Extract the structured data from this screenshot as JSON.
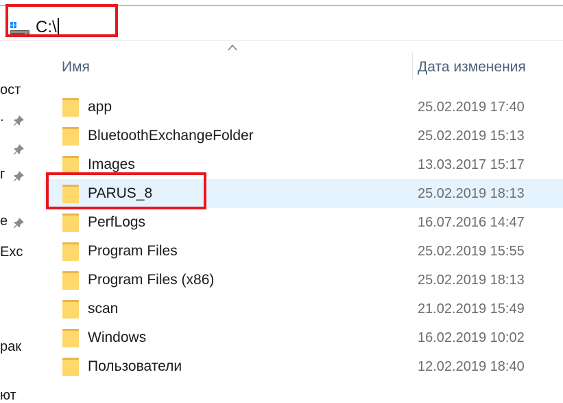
{
  "address_bar": {
    "path": "C:\\"
  },
  "nav_pane": {
    "items": [
      {
        "text": "ост",
        "pinned": false
      },
      {
        "text": "·",
        "pinned": true
      },
      {
        "text": "",
        "pinned": true
      },
      {
        "text": "г",
        "pinned": true
      },
      {
        "text": "е",
        "pinned": true
      },
      {
        "text": "Exc",
        "pinned": false
      },
      {
        "text": "рак",
        "pinned": false
      },
      {
        "text": "ют",
        "pinned": false
      }
    ]
  },
  "columns": {
    "name": "Имя",
    "date_modified": "Дата изменения",
    "sorted_by": "name"
  },
  "files": [
    {
      "name": "app",
      "date": "25.02.2019 17:40",
      "icon": "folder-icon",
      "selected": false
    },
    {
      "name": "BluetoothExchangeFolder",
      "date": "25.02.2019 15:13",
      "icon": "folder-icon",
      "selected": false
    },
    {
      "name": "Images",
      "date": "13.03.2017 15:17",
      "icon": "folder-icon",
      "selected": false
    },
    {
      "name": "PARUS_8",
      "date": "25.02.2019 18:13",
      "icon": "folder-icon",
      "selected": true
    },
    {
      "name": "PerfLogs",
      "date": "16.07.2016 14:47",
      "icon": "folder-icon",
      "selected": false
    },
    {
      "name": "Program Files",
      "date": "25.02.2019 15:55",
      "icon": "folder-icon",
      "selected": false
    },
    {
      "name": "Program Files (x86)",
      "date": "25.02.2019 18:13",
      "icon": "folder-icon",
      "selected": false
    },
    {
      "name": "scan",
      "date": "21.02.2019 15:49",
      "icon": "folder-icon",
      "selected": false
    },
    {
      "name": "Windows",
      "date": "16.02.2019 10:02",
      "icon": "folder-icon",
      "selected": false
    },
    {
      "name": "Пользователи",
      "date": "12.02.2019 18:40",
      "icon": "folder-icon",
      "selected": false
    }
  ],
  "colors": {
    "highlight_box": "#e8171d",
    "selected_row": "#e5f3ff",
    "folder_fill": "#ffd86b",
    "folder_tab": "#e8b64c",
    "header_text": "#4c607a",
    "date_text": "#6d6d6d"
  }
}
